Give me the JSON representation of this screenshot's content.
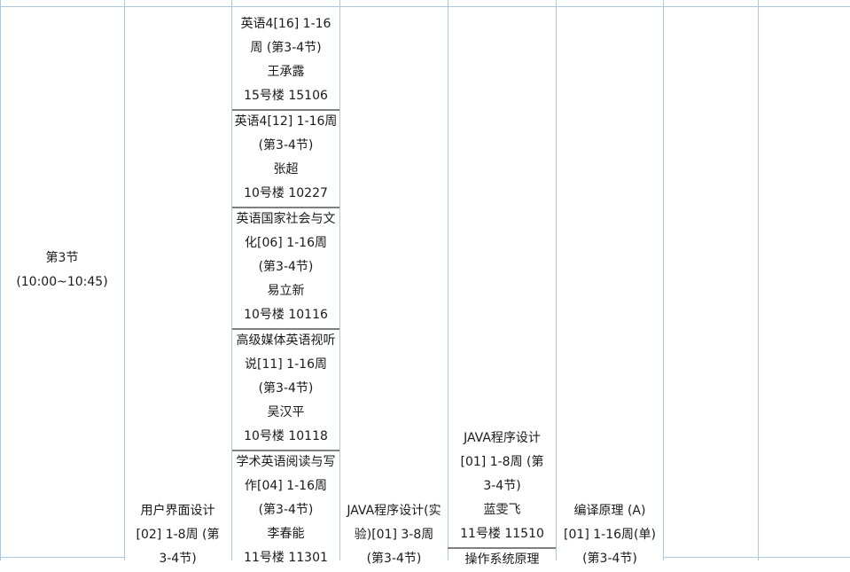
{
  "time_cell": {
    "period": "第3节",
    "time": "(10:00~10:45)"
  },
  "top_stub": "",
  "tue_courses": [
    {
      "lines": [
        "英语4[16]  1-16",
        "周  (第3-4节)",
        "王承露",
        "15号楼 15106"
      ]
    },
    {
      "lines": [
        "英语4[12]  1-16周",
        "(第3-4节)",
        "张超",
        "10号楼 10227"
      ]
    },
    {
      "lines": [
        "英语国家社会与文",
        "化[06]  1-16周",
        "(第3-4节)",
        "易立新",
        "10号楼 10116"
      ]
    },
    {
      "lines": [
        "高级媒体英语视听",
        "说[11]  1-16周",
        "(第3-4节)",
        "吴汉平",
        "10号楼 10118"
      ]
    },
    {
      "lines": [
        "学术英语阅读与写",
        "作[04]  1-16周",
        "(第3-4节)",
        "李春能",
        "11号楼 11301"
      ]
    }
  ],
  "mon_course": {
    "lines": [
      "用户界面设计",
      "[02]  1-8周  (第",
      "3-4节)"
    ]
  },
  "wed_course": {
    "lines": [
      "JAVA程序设计(实",
      "验)[01]  3-8周",
      "(第3-4节)"
    ]
  },
  "thu_courses": [
    {
      "lines": [
        "JAVA程序设计",
        "[01]  1-8周  (第",
        "3-4节)",
        "蓝雯飞",
        "11号楼 11510"
      ]
    },
    {
      "lines": [
        "操作系统原理"
      ]
    }
  ],
  "fri_course": {
    "lines": [
      "编译原理  (A)",
      "[01]  1-16周(单)",
      "(第3-4节)"
    ]
  }
}
